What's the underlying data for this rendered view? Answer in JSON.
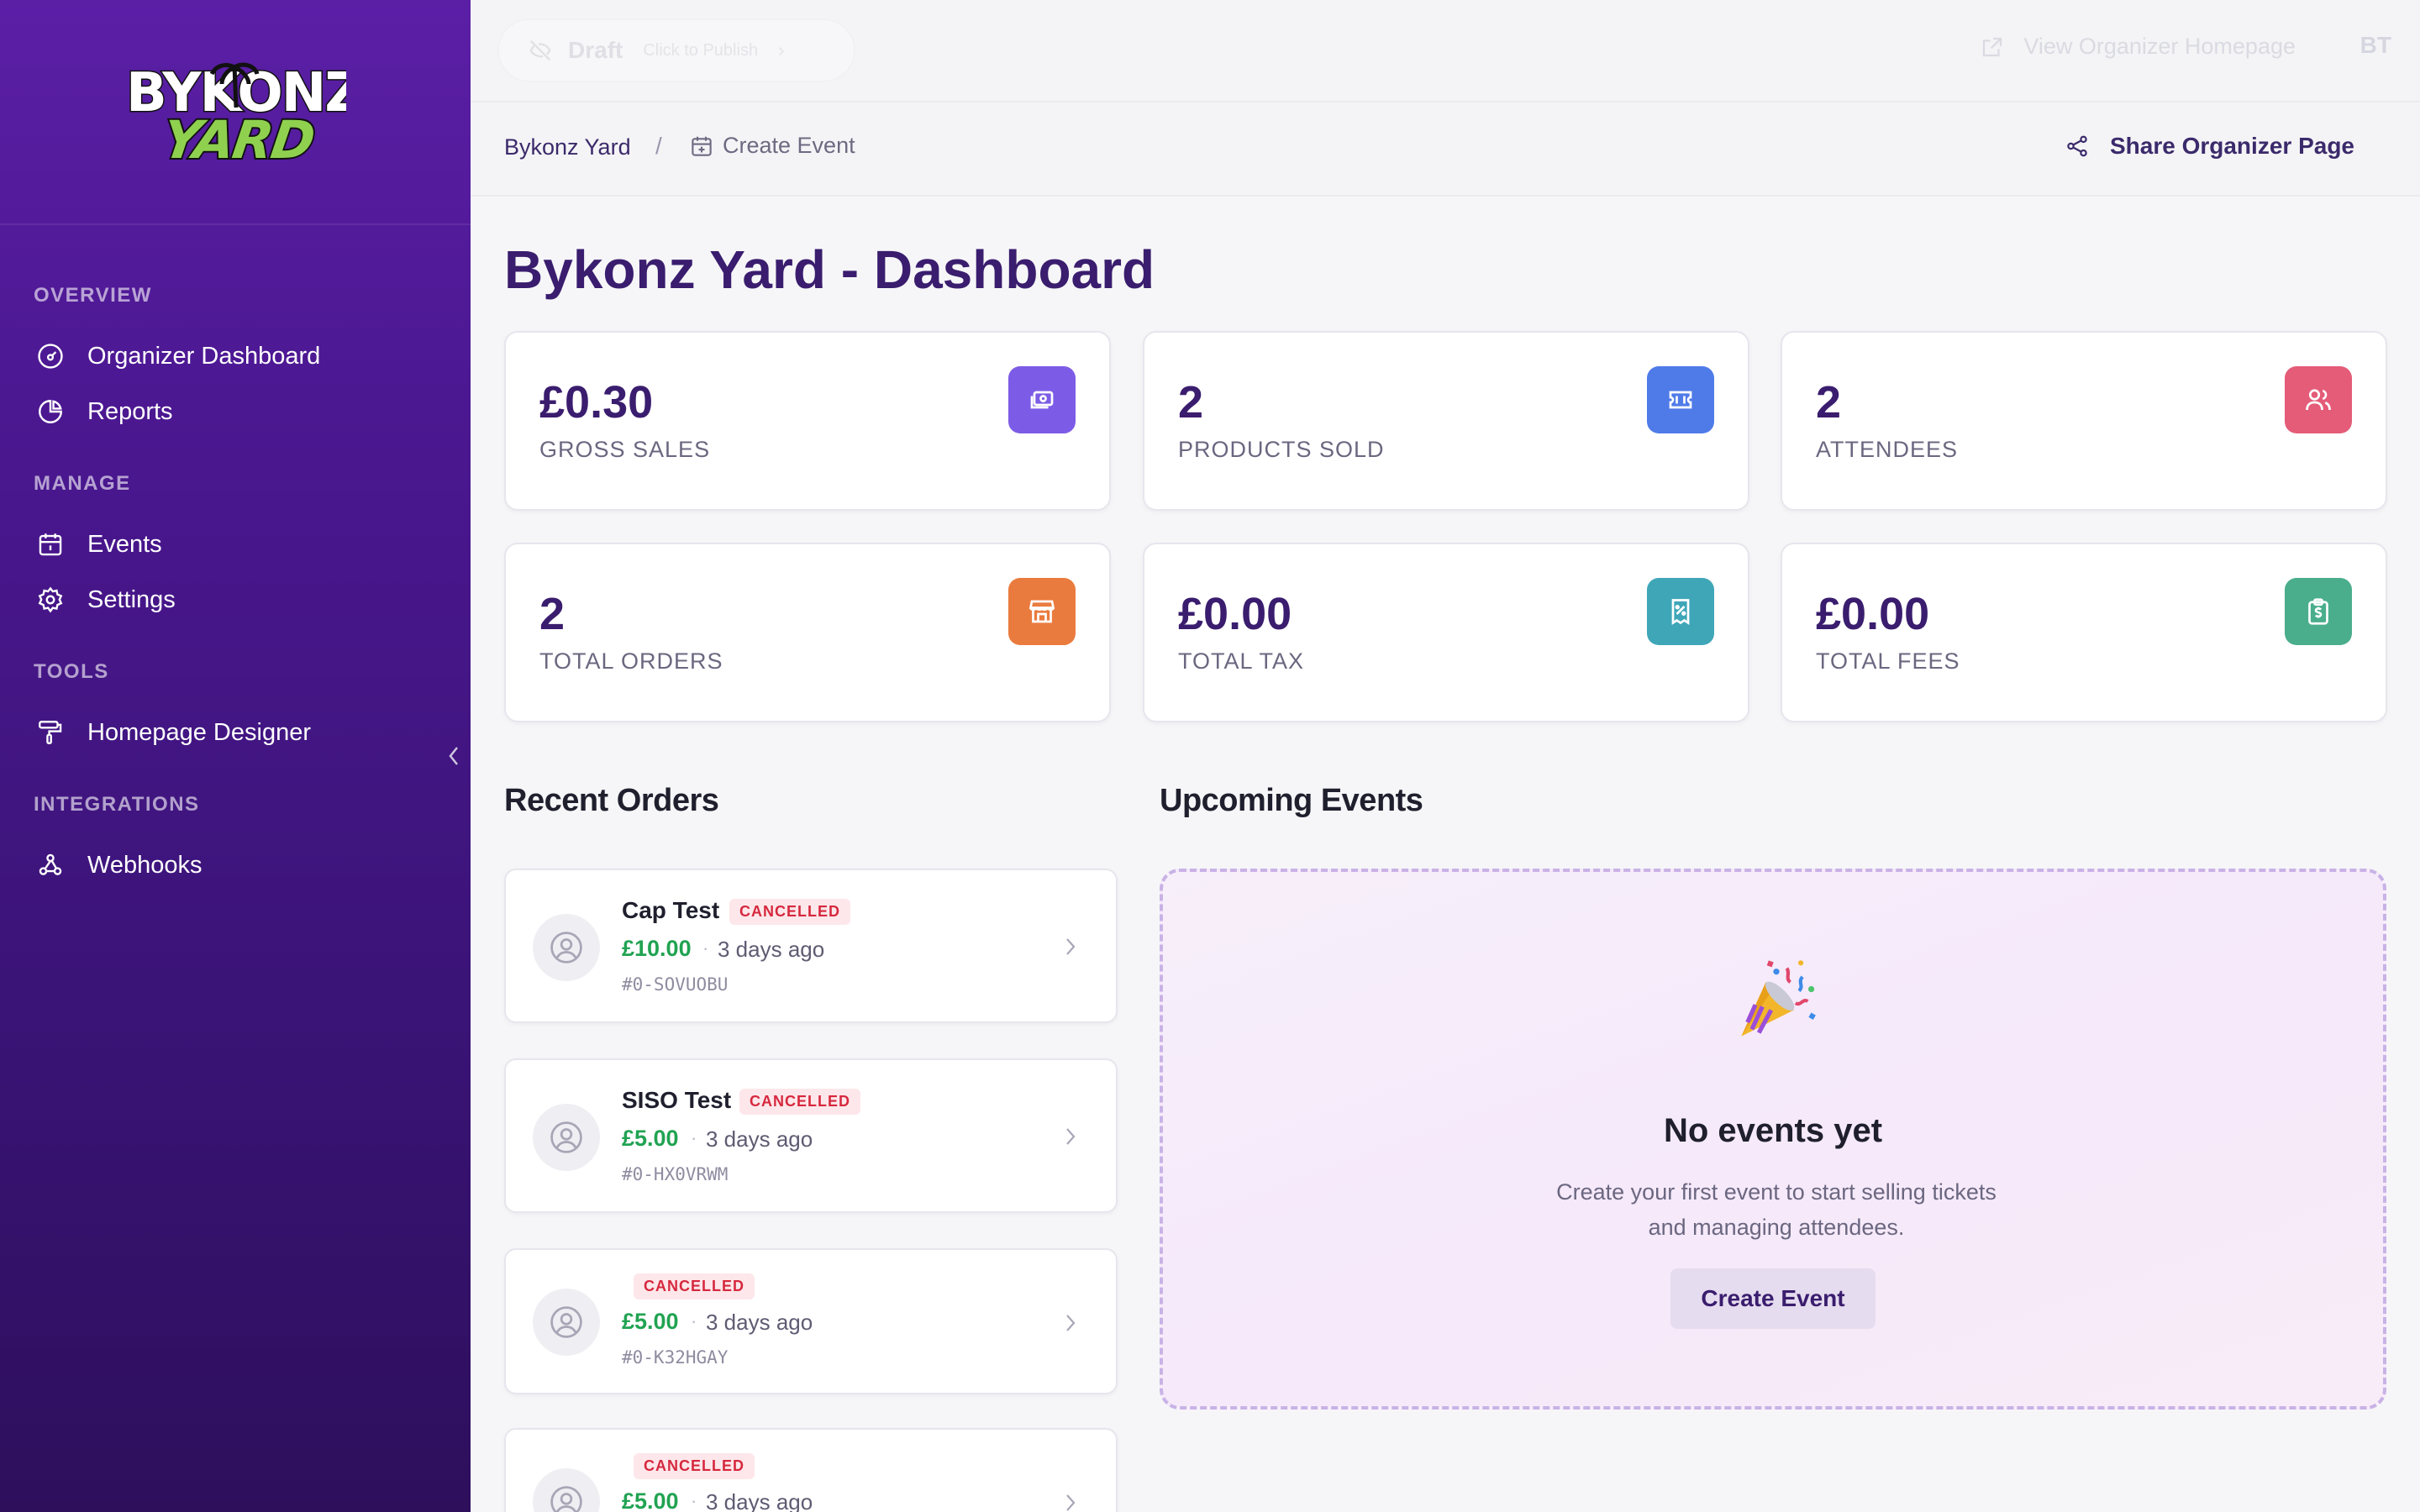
{
  "brand": {
    "logo_line1": "BYKONZ",
    "logo_line2": "YARD"
  },
  "sidebar": {
    "sections": [
      {
        "title": "OVERVIEW",
        "items": [
          {
            "label": "Organizer Dashboard",
            "icon": "gauge-icon"
          },
          {
            "label": "Reports",
            "icon": "pie-chart-icon"
          }
        ]
      },
      {
        "title": "MANAGE",
        "items": [
          {
            "label": "Events",
            "icon": "calendar-icon"
          },
          {
            "label": "Settings",
            "icon": "gear-icon"
          }
        ]
      },
      {
        "title": "TOOLS",
        "items": [
          {
            "label": "Homepage Designer",
            "icon": "paint-roller-icon"
          }
        ]
      },
      {
        "title": "INTEGRATIONS",
        "items": [
          {
            "label": "Webhooks",
            "icon": "webhook-icon"
          }
        ]
      }
    ]
  },
  "topbar": {
    "status_label": "Draft",
    "status_hint": "Click to Publish",
    "view_homepage_label": "View Organizer Homepage",
    "user_initials": "BT"
  },
  "breadcrumb": {
    "root": "Bykonz Yard",
    "separator": "/",
    "current": "Create Event"
  },
  "share_label": "Share Organizer Page",
  "page_title": "Bykonz Yard - Dashboard",
  "stats": [
    {
      "value": "£0.30",
      "label": "GROSS SALES",
      "icon": "cash-icon",
      "color": "#7c5ce6"
    },
    {
      "value": "2",
      "label": "PRODUCTS SOLD",
      "icon": "ticket-icon",
      "color": "#4f7be8"
    },
    {
      "value": "2",
      "label": "ATTENDEES",
      "icon": "users-icon",
      "color": "#e45c78"
    },
    {
      "value": "2",
      "label": "TOTAL ORDERS",
      "icon": "store-icon",
      "color": "#ea7b3e"
    },
    {
      "value": "£0.00",
      "label": "TOTAL TAX",
      "icon": "receipt-tax-icon",
      "color": "#3fa6b8"
    },
    {
      "value": "£0.00",
      "label": "TOTAL FEES",
      "icon": "clipboard-dollar-icon",
      "color": "#4aae8c"
    }
  ],
  "recent_orders": {
    "title": "Recent Orders",
    "orders": [
      {
        "name": "Cap Test",
        "status": "CANCELLED",
        "amount": "£10.00",
        "time": "3 days ago",
        "id": "#0-SOVUOBU"
      },
      {
        "name": "SISO Test",
        "status": "CANCELLED",
        "amount": "£5.00",
        "time": "3 days ago",
        "id": "#0-HX0VRWM"
      },
      {
        "name": "",
        "status": "CANCELLED",
        "amount": "£5.00",
        "time": "3 days ago",
        "id": "#0-K32HGAY"
      },
      {
        "name": "",
        "status": "CANCELLED",
        "amount": "£5.00",
        "time": "3 days ago",
        "id": ""
      }
    ],
    "dot": "·"
  },
  "upcoming_events": {
    "title": "Upcoming Events",
    "empty_emoji": "party-popper-icon",
    "empty_title": "No events yet",
    "empty_desc_line1": "Create your first event to start selling tickets",
    "empty_desc_line2": "and managing attendees.",
    "cta_label": "Create Event"
  }
}
